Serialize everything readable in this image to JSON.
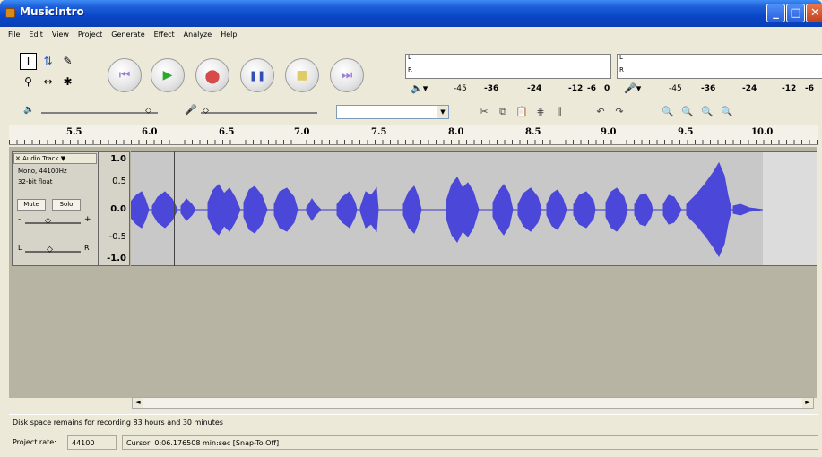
{
  "window": {
    "title": "MusicIntro",
    "minimize": "_",
    "maximize": "□",
    "close": "✕"
  },
  "menu": [
    "File",
    "Edit",
    "View",
    "Project",
    "Generate",
    "Effect",
    "Analyze",
    "Help"
  ],
  "tools": {
    "selection": "I",
    "envelope": "⇅",
    "draw": "✎",
    "zoom": "⚲",
    "timeshift": "↔",
    "multi": "✱"
  },
  "transport": {
    "skip_start": "⏮",
    "play": "▶",
    "record": "●",
    "pause": "❚❚",
    "stop": "■",
    "skip_end": "⏭"
  },
  "meters": {
    "play_L": "L",
    "play_R": "R",
    "rec_L": "L",
    "rec_R": "R",
    "play_scale": [
      "-45",
      "-36",
      "-24",
      "-12",
      "-6",
      "0"
    ],
    "rec_scale": [
      "-45",
      "-36",
      "-24",
      "-12",
      "-6"
    ]
  },
  "mixer": {
    "speaker_icon": "🔈",
    "mic_icon": "🎤",
    "combo_arrow": "▼"
  },
  "ruler": [
    "5.5",
    "6.0",
    "6.5",
    "7.0",
    "7.5",
    "8.0",
    "8.5",
    "9.0",
    "9.5",
    "10.0"
  ],
  "track": {
    "name": "Audio Track ▼",
    "close": "✕",
    "info1": "Mono, 44100Hz",
    "info2": "32-bit float",
    "mute": "Mute",
    "solo": "Solo",
    "gain_minus": "-",
    "gain_plus": "+",
    "pan_left": "L",
    "pan_right": "R",
    "scale": [
      "1.0",
      "0.5",
      "0.0",
      "-0.5",
      "-1.0"
    ]
  },
  "scroll": {
    "left": "◄",
    "right": "►"
  },
  "status": {
    "disk": "Disk space remains for recording 83 hours and 30 minutes",
    "project_rate_label": "Project rate:",
    "project_rate": "44100",
    "cursor": "Cursor: 0:06.176508 min:sec   [Snap-To Off]"
  }
}
